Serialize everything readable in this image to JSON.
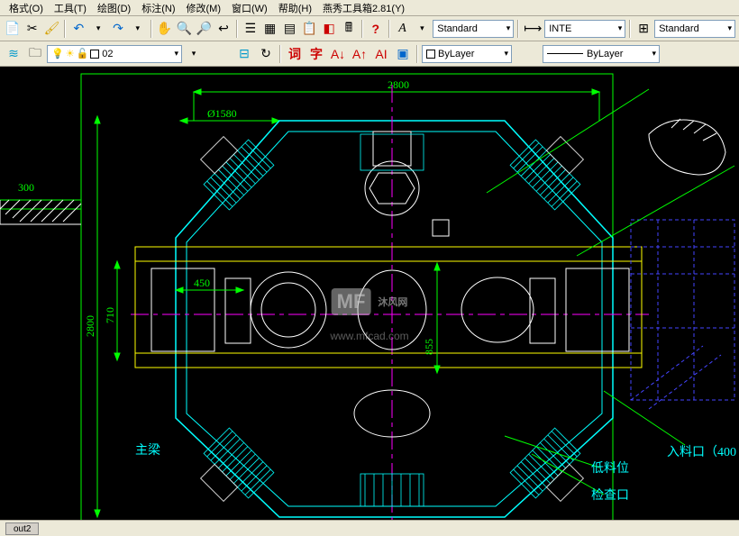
{
  "menu": {
    "format": "格式(O)",
    "tools": "工具(T)",
    "draw": "绘图(D)",
    "dim": "标注(N)",
    "modify": "修改(M)",
    "window": "窗口(W)",
    "help": "帮助(H)",
    "yanxiu": "燕秀工具箱2.81(Y)"
  },
  "toolbar1": {
    "style_dd": "Standard",
    "inte_dd": "INTE",
    "std2_dd": "Standard"
  },
  "toolbar2": {
    "layer": "02",
    "ci": "词",
    "zi": "字",
    "bylayer": "ByLayer",
    "bylayer2": "ByLayer"
  },
  "drawing": {
    "dim_phi": "Ø1580",
    "dim_2800v": "2800",
    "dim_2800h": "2800",
    "dim_300": "300",
    "dim_450": "450",
    "dim_710": "710",
    "dim_855": "855",
    "note_beam": "主梁",
    "note_low": "低料位",
    "note_inspect": "检查口",
    "note_inlet": "入料口（400"
  },
  "watermark": {
    "text": "沐风网",
    "url": "www.mfcad.com"
  },
  "status": {
    "tab": "out2"
  }
}
